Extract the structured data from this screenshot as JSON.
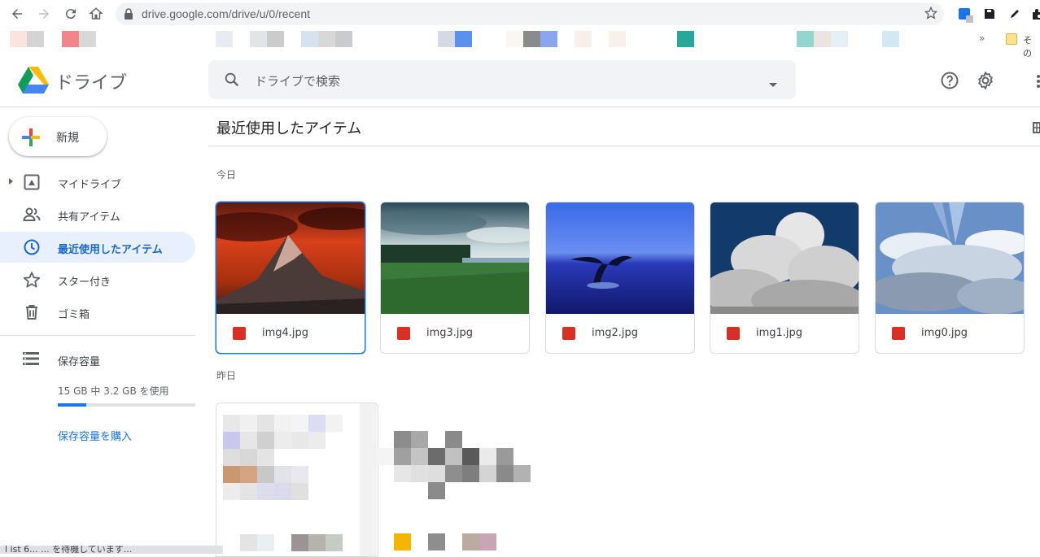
{
  "browser": {
    "url": "drive.google.com/drive/u/0/recent",
    "bookmarks_more": "»",
    "other_bookmarks": "その"
  },
  "header": {
    "app_name": "ドライブ",
    "search_placeholder": "ドライブで検索"
  },
  "sidebar": {
    "new_label": "新規",
    "items": [
      {
        "label": "マイドライブ",
        "icon": "my-drive-icon"
      },
      {
        "label": "共有アイテム",
        "icon": "shared-icon"
      },
      {
        "label": "最近使用したアイテム",
        "icon": "clock-icon",
        "active": true
      },
      {
        "label": "スター付き",
        "icon": "star-icon"
      },
      {
        "label": "ゴミ箱",
        "icon": "trash-icon"
      }
    ],
    "storage": {
      "label": "保存容量",
      "used_text": "15 GB 中 3.2 GB を使用",
      "used_fraction": 0.21,
      "buy_label": "保存容量を購入"
    }
  },
  "main": {
    "title": "最近使用したアイテム",
    "sections": [
      {
        "label": "今日"
      },
      {
        "label": "昨日"
      }
    ],
    "files": [
      {
        "name": "img4.jpg",
        "selected": true
      },
      {
        "name": "img3.jpg"
      },
      {
        "name": "img2.jpg"
      },
      {
        "name": "img1.jpg"
      },
      {
        "name": "img0.jpg"
      }
    ]
  },
  "status": {
    "text": "l ist 6... ... を待機しています..."
  },
  "colors": {
    "accent": "#1a73e8",
    "active_bg": "#e8f0fe",
    "image_icon": "#d93025"
  }
}
